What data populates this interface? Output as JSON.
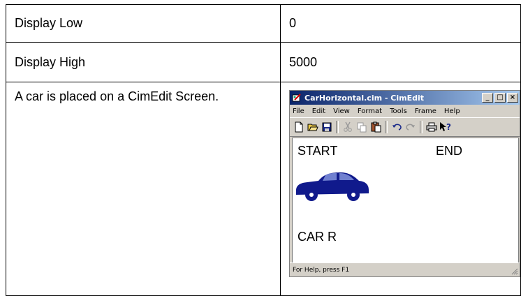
{
  "rows": [
    {
      "label": "Display Low",
      "value": "0"
    },
    {
      "label": "Display High",
      "value": "5000"
    },
    {
      "label": "A car is placed on a CimEdit Screen."
    }
  ],
  "window": {
    "title": "CarHorizontal.cim - CimEdit",
    "controls": {
      "minimize": "_",
      "maximize": "□",
      "close": "×"
    },
    "menu": [
      "File",
      "Edit",
      "View",
      "Format",
      "Tools",
      "Frame",
      "Help"
    ],
    "toolbar_icons": [
      "new-icon",
      "open-icon",
      "save-icon",
      "cut-icon",
      "copy-icon",
      "paste-icon",
      "undo-icon",
      "redo-icon",
      "print-icon",
      "help-pointer-icon"
    ],
    "canvas": {
      "start_label": "START",
      "end_label": "END",
      "car_label": "CAR R",
      "car_color": "#101a8c"
    },
    "status": "For Help, press F1"
  }
}
